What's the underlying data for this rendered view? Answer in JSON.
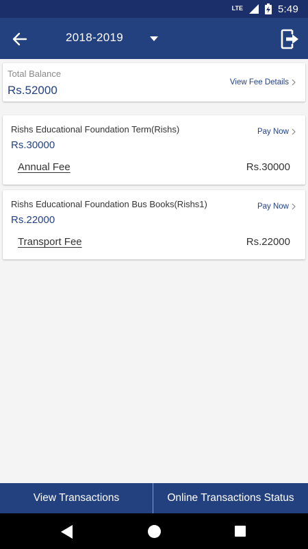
{
  "status_bar": {
    "network": "LTE",
    "time": "5:49"
  },
  "toolbar": {
    "year": "2018-2019"
  },
  "balance": {
    "label": "Total Balance",
    "amount": "Rs.52000",
    "link": "View Fee Details"
  },
  "fees": [
    {
      "title": "Rishs Educational Foundation Term(Rishs)",
      "total": "Rs.30000",
      "action": "Pay Now",
      "item_name": "Annual Fee",
      "item_amount": "Rs.30000"
    },
    {
      "title": "Rishs Educational Foundation Bus Books(Rishs1)",
      "total": "Rs.22000",
      "action": "Pay Now",
      "item_name": "Transport Fee",
      "item_amount": "Rs.22000"
    }
  ],
  "bottom_bar": {
    "view_transactions": "View Transactions",
    "online_status": "Online Transactions Status"
  },
  "colors": {
    "primary": "#24417f",
    "status_bar": "#1b2f6a",
    "background": "#f4f4f4"
  }
}
